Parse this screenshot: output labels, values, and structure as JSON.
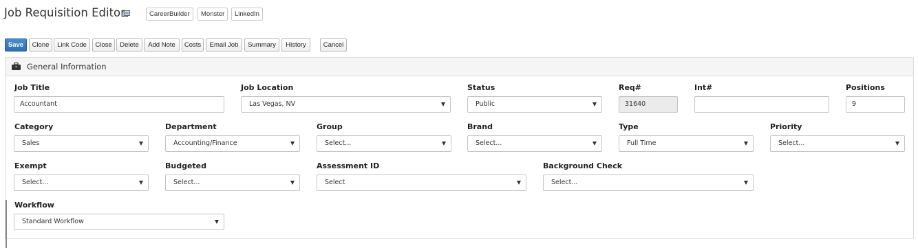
{
  "header": {
    "title": "Job Requisition Editor",
    "title_icon": "copy-icon",
    "job_boards": [
      "CareerBuilder",
      "Monster",
      "LinkedIn"
    ]
  },
  "toolbar": {
    "save": "Save",
    "clone": "Clone",
    "link_code": "Link Code",
    "close": "Close",
    "delete": "Delete",
    "add_note": "Add Note",
    "costs": "Costs",
    "email_job": "Email Job",
    "summary": "Summary",
    "history": "History",
    "cancel": "Cancel",
    "primary_color": "#337ab7"
  },
  "panel": {
    "title": "General Information",
    "icon": "briefcase-icon"
  },
  "fields": {
    "job_title": {
      "label": "Job Title",
      "value": "Accountant"
    },
    "job_location": {
      "label": "Job Location",
      "value": "Las Vegas, NV"
    },
    "status": {
      "label": "Status",
      "value": "Public"
    },
    "req": {
      "label": "Req#",
      "value": "31640"
    },
    "int": {
      "label": "Int#",
      "value": ""
    },
    "positions": {
      "label": "Positions",
      "value": "9"
    },
    "category": {
      "label": "Category",
      "value": "Sales"
    },
    "department": {
      "label": "Department",
      "value": "Accounting/Finance"
    },
    "group": {
      "label": "Group",
      "value": "Select..."
    },
    "brand": {
      "label": "Brand",
      "value": "Select..."
    },
    "type": {
      "label": "Type",
      "value": "Full Time"
    },
    "priority": {
      "label": "Priority",
      "value": "Select..."
    },
    "exempt": {
      "label": "Exempt",
      "value": "Select..."
    },
    "budgeted": {
      "label": "Budgeted",
      "value": "Select..."
    },
    "assessment_id": {
      "label": "Assessment ID",
      "value": "Select"
    },
    "background_check": {
      "label": "Background Check",
      "value": "Select..."
    },
    "workflow": {
      "label": "Workflow",
      "value": "Standard Workflow"
    }
  }
}
